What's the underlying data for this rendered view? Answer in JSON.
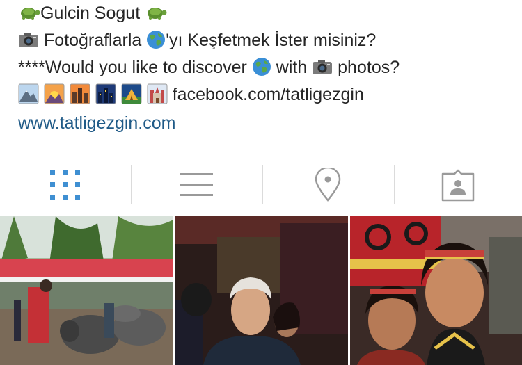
{
  "profile": {
    "name": "Gulcin Sogut",
    "bio_line_1": "Fotoğraflarla",
    "bio_line_1_rest": "'yı Keşfetmek İster misiniz?",
    "bio_line_2_start": "****Would you like to discover",
    "bio_line_2_mid": "with",
    "bio_line_2_end": "photos?",
    "bio_line_3": "facebook.com/tatligezgin",
    "website": "www.tatligezgin.com"
  },
  "tabs": [
    {
      "name": "grid-view",
      "icon": "grid-icon",
      "active": true
    },
    {
      "name": "list-view",
      "icon": "list-icon",
      "active": false
    },
    {
      "name": "map-view",
      "icon": "location-pin-icon",
      "active": false
    },
    {
      "name": "tagged-view",
      "icon": "tagged-person-icon",
      "active": false
    }
  ],
  "colors": {
    "active_tab": "#3f8fd2",
    "inactive_tab": "#9a9a9a",
    "link": "#1f5a87"
  },
  "photos": [
    {
      "name": "buffalo-market-photo"
    },
    {
      "name": "elderly-woman-smiling-photo"
    },
    {
      "name": "girls-traditional-dress-photo"
    }
  ]
}
